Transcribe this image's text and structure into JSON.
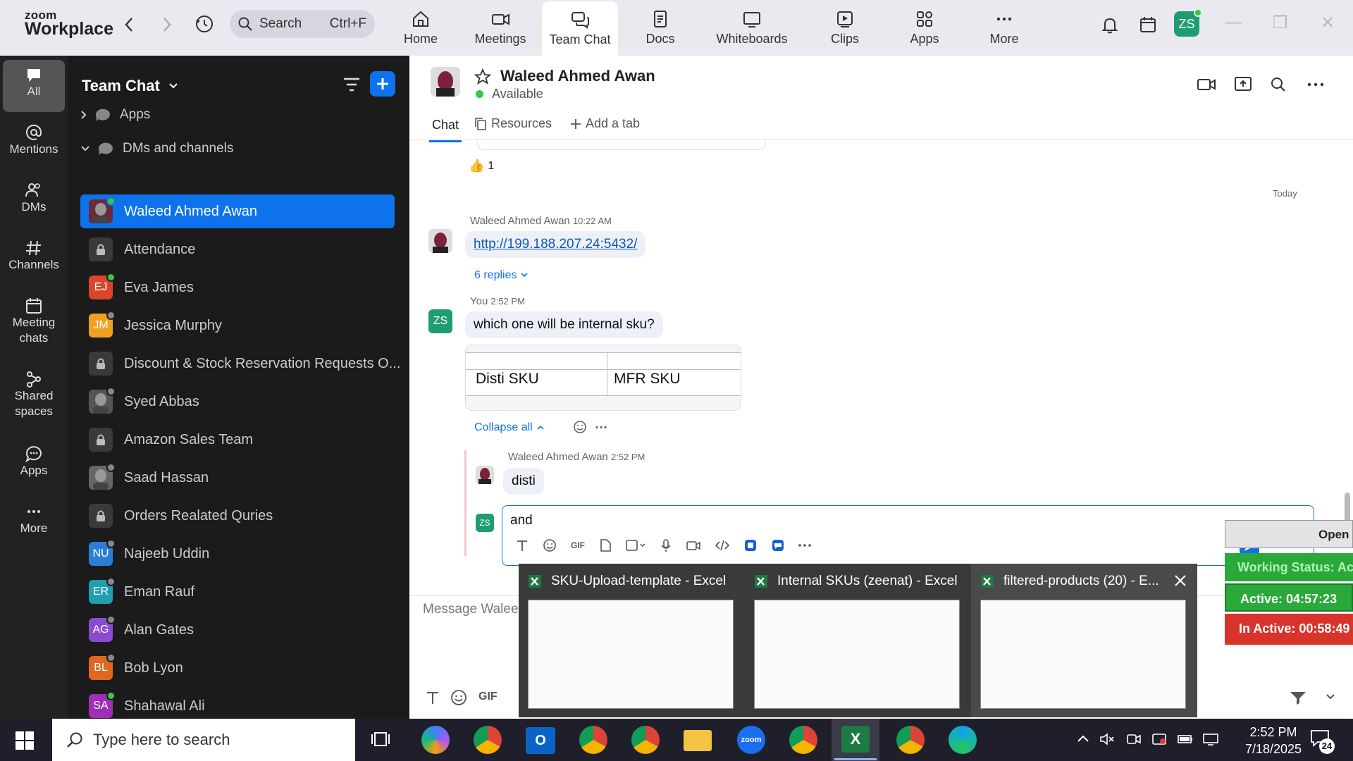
{
  "topbar": {
    "logo_top": "zoom",
    "logo_bottom": "Workplace",
    "search_placeholder": "Search",
    "search_shortcut": "Ctrl+F",
    "tabs": [
      {
        "label": "Home"
      },
      {
        "label": "Meetings"
      },
      {
        "label": "Team Chat"
      },
      {
        "label": "Docs"
      },
      {
        "label": "Whiteboards"
      },
      {
        "label": "Clips"
      },
      {
        "label": "Apps"
      },
      {
        "label": "More"
      }
    ],
    "avatar": "ZS"
  },
  "rail": [
    {
      "label": "All"
    },
    {
      "label": "Mentions"
    },
    {
      "label": "DMs"
    },
    {
      "label": "Channels"
    },
    {
      "label": "Meeting chats"
    },
    {
      "label": "Shared spaces"
    },
    {
      "label": "Apps"
    },
    {
      "label": "More"
    }
  ],
  "sidebar": {
    "title": "Team Chat",
    "sections": {
      "apps": "Apps",
      "dms": "DMs and channels"
    },
    "items": [
      {
        "label": "Waleed Ahmed Awan",
        "initials": "",
        "color": "#6b2a3a",
        "status": "#2ecc40"
      },
      {
        "label": "Attendance",
        "initials": "",
        "color": "#3a3a3a",
        "status": ""
      },
      {
        "label": "Eva James",
        "initials": "EJ",
        "color": "#d9442c",
        "status": "#2ecc40"
      },
      {
        "label": "Jessica Murphy",
        "initials": "JM",
        "color": "#f0a020",
        "status": "#888"
      },
      {
        "label": "Discount & Stock Reservation Requests O...",
        "initials": "",
        "color": "#3a3a3a",
        "status": ""
      },
      {
        "label": "Syed Abbas",
        "initials": "",
        "color": "#555",
        "status": "#888"
      },
      {
        "label": "Amazon Sales Team",
        "initials": "",
        "color": "#3a3a3a",
        "status": ""
      },
      {
        "label": "Saad Hassan",
        "initials": "",
        "color": "#666",
        "status": "#888"
      },
      {
        "label": "Orders Realated Quries",
        "initials": "",
        "color": "#3a3a3a",
        "status": ""
      },
      {
        "label": "Najeeb Uddin",
        "initials": "NU",
        "color": "#2a7fd4",
        "status": "#888"
      },
      {
        "label": "Eman Rauf",
        "initials": "ER",
        "color": "#1f9fb0",
        "status": "#888"
      },
      {
        "label": "Alan Gates",
        "initials": "AG",
        "color": "#8b4bd1",
        "status": "#888"
      },
      {
        "label": "Bob Lyon",
        "initials": "BL",
        "color": "#e0671f",
        "status": "#888"
      },
      {
        "label": "Shahawal Ali",
        "initials": "SA",
        "color": "#a02fb5",
        "status": "#2ecc40"
      }
    ]
  },
  "chat": {
    "contact": "Waleed Ahmed Awan",
    "presence": "Available",
    "tabs": {
      "chat": "Chat",
      "resources": "Resources",
      "add": "Add a tab"
    },
    "reaction_count": "1",
    "day_divider": "Today",
    "msg1": {
      "author": "Waleed Ahmed Awan",
      "time": "10:22 AM",
      "link": "http://199.188.207.24:5432/",
      "replies": "6 replies"
    },
    "msg2": {
      "author": "You",
      "time": "2:52 PM",
      "avatar": "ZS",
      "text": "which one will be internal sku?",
      "col1": "Disti SKU",
      "col2": "MFR SKU"
    },
    "collapse": "Collapse all",
    "reply": {
      "author": "Waleed Ahmed Awan",
      "time": "2:52 PM",
      "text": "disti"
    },
    "reply_input": "and",
    "reply_avatar": "ZS",
    "composer_placeholder": "Message Waleed"
  },
  "overlay": {
    "open": "Open",
    "working": "Working Status: Ac",
    "active": "Active: 04:57:23",
    "inactive": "In Active: 00:58:49"
  },
  "thumbs": [
    {
      "title": "SKU-Upload-template - Excel"
    },
    {
      "title": "Internal SKUs (zeenat) - Excel"
    },
    {
      "title": "filtered-products (20) - E..."
    }
  ],
  "taskbar": {
    "search": "Type here to search",
    "time": "2:52 PM",
    "date": "7/18/2025",
    "notif": "24"
  }
}
